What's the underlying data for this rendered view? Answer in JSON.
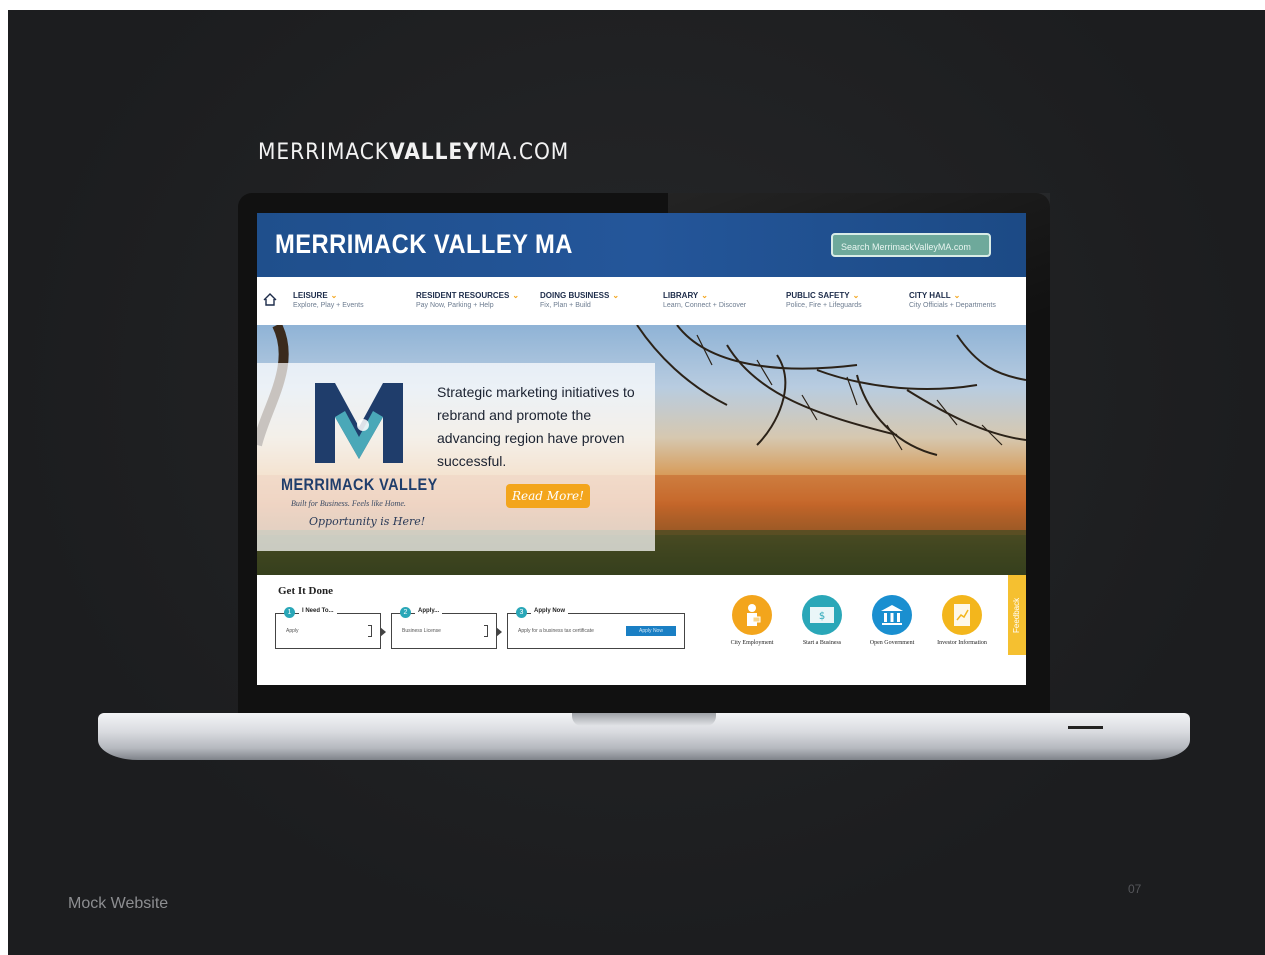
{
  "slide": {
    "site_url_prefix": "MERRIMACK",
    "site_url_bold": "VALLEY",
    "site_url_suffix": "MA.COM",
    "footer_label": "Mock Website",
    "page_number": "07"
  },
  "header": {
    "title": "MERRIMACK VALLEY MA",
    "search_placeholder": "Search MerrimackValleyMA.com"
  },
  "nav": {
    "items": [
      {
        "title": "LEISURE",
        "sub": "Explore, Play + Events"
      },
      {
        "title": "RESIDENT RESOURCES",
        "sub": "Pay Now, Parking + Help"
      },
      {
        "title": "DOING BUSINESS",
        "sub": "Fix, Plan + Build"
      },
      {
        "title": "LIBRARY",
        "sub": "Learn, Connect + Discover"
      },
      {
        "title": "PUBLIC SAFETY",
        "sub": "Police, Fire + Lifeguards"
      },
      {
        "title": "CITY HALL",
        "sub": "City Officials + Departments"
      }
    ]
  },
  "hero": {
    "brand": "MERRIMACK VALLEY",
    "tagline": "Built for Business. Feels like Home.",
    "script": "Opportunity is Here!",
    "text": "Strategic marketing initiatives to rebrand and promote the advancing region have proven successful.",
    "button": "Read More!"
  },
  "get_it_done": {
    "title": "Get It Done",
    "steps": [
      {
        "num": "1",
        "label": "I Need To...",
        "value": "Apply"
      },
      {
        "num": "2",
        "label": "Apply...",
        "value": "Business License"
      },
      {
        "num": "3",
        "label": "Apply Now",
        "value": "Apply for a business tax certificate",
        "button": "Apply Now"
      }
    ],
    "quick_links": [
      {
        "label": "City Employment",
        "color": "#f3a51c"
      },
      {
        "label": "Start a Business",
        "color": "#2aa7b8"
      },
      {
        "label": "Open Government",
        "color": "#1a8fd0"
      },
      {
        "label": "Investor Information",
        "color": "#f3b61c"
      }
    ],
    "feedback": "Feedback"
  },
  "colors": {
    "header_blue": "#1f4f8c",
    "accent_orange": "#f3a51c",
    "search_green": "#6ea99b",
    "slide_bg": "#1c1d1f"
  }
}
